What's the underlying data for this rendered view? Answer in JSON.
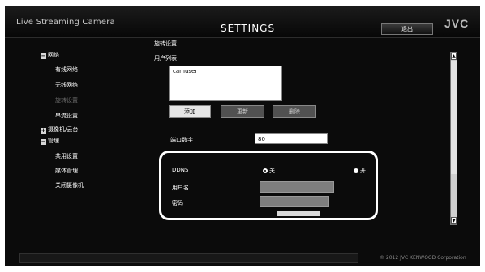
{
  "header": {
    "app_name": "Live Streaming Camera",
    "title": "SETTINGS",
    "exit_label": "退出",
    "logo": "JVC"
  },
  "sidebar": {
    "network": {
      "label": "网络",
      "expander": "−"
    },
    "wired": "有线网络",
    "wireless": "无线网络",
    "broadcast": "旋转设置",
    "streaming": "串流设置",
    "camera": {
      "label": "摄像机/云台",
      "expander": "+"
    },
    "management": {
      "label": "管理",
      "expander": "−"
    },
    "shared": "共用设置",
    "media": "媒体管理",
    "shutdown": "关闭摄像机"
  },
  "content": {
    "section_title": "旋转设置",
    "user_list_label": "用户列表",
    "users": [
      "camuser"
    ],
    "buttons": {
      "add": "添加",
      "edit": "更新",
      "delete": "删除"
    },
    "port": {
      "label": "端口数字",
      "value": "80"
    },
    "ddns": {
      "label": "DDNS",
      "off": "关",
      "on": "开",
      "selected": "off"
    },
    "username_label": "用户名",
    "password_label": "密码"
  },
  "scrollbar": {
    "up": "▲",
    "down": "▼"
  },
  "footer": {
    "copyright": "© 2012 JVC KENWOOD Corporation"
  }
}
